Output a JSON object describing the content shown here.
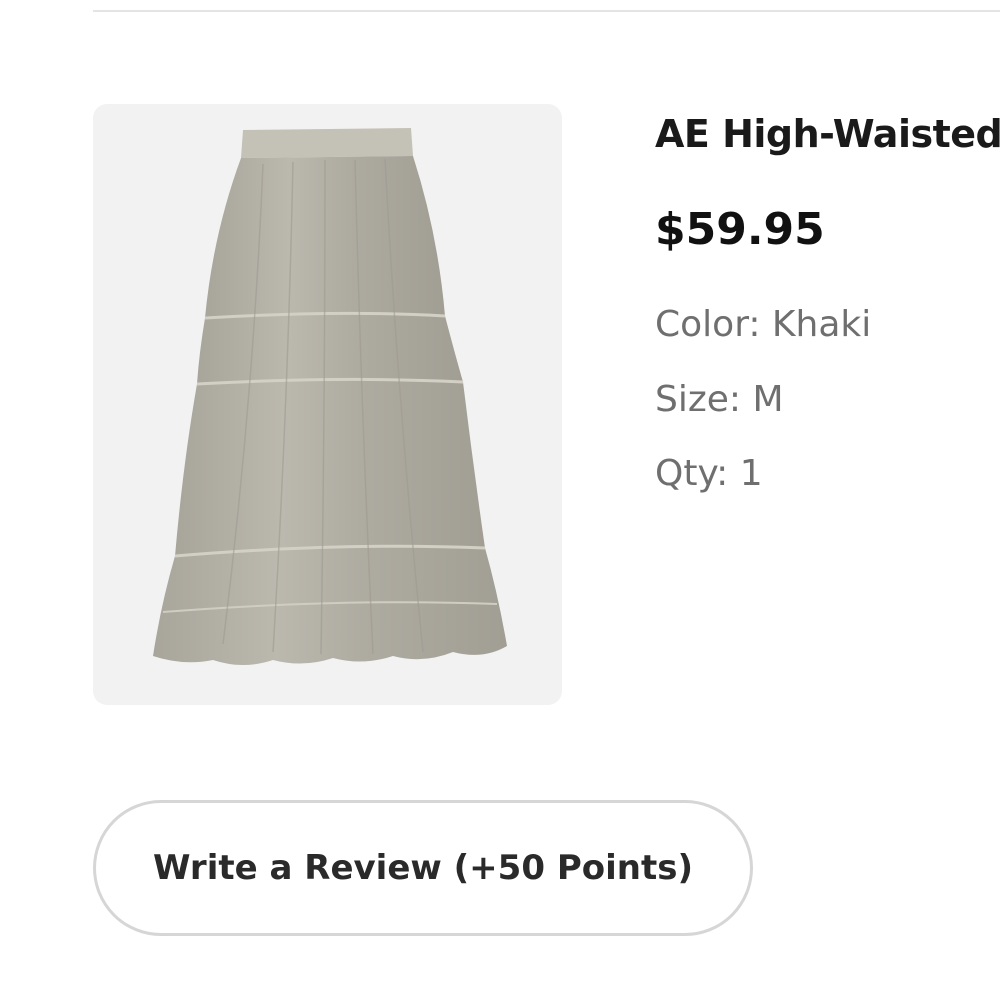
{
  "product": {
    "name": "AE High-Waisted Tiered Maxi Skirt",
    "price": "$59.95",
    "image_icon": "skirt-image",
    "attributes": {
      "color": "Color: Khaki",
      "size": "Size: M",
      "qty": "Qty: 1"
    }
  },
  "actions": {
    "review_label": "Write a Review (+50 Points)"
  },
  "colors": {
    "skirt_fabric": "#b3b0a5",
    "image_background": "#f2f2f2",
    "attribute_text": "#6f6f6f",
    "button_border": "#d6d6d6"
  }
}
